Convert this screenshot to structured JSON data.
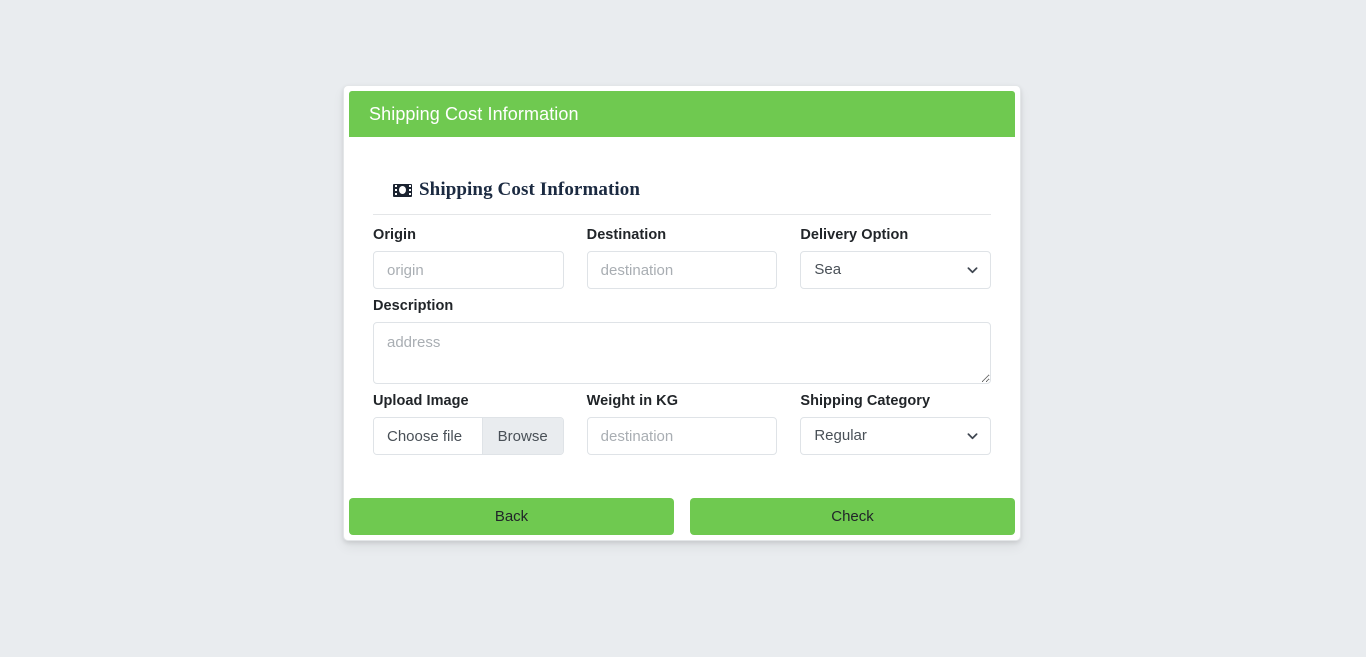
{
  "theme": {
    "accent_green": "#6fc950",
    "page_background": "#e9ecef",
    "card_background": "#ffffff",
    "input_border": "#dfe3e7",
    "label_color": "#212529"
  },
  "card": {
    "header_title": "Shipping Cost Information",
    "legend": {
      "icon": "money-bill-icon",
      "text": "Shipping Cost Information"
    }
  },
  "form": {
    "origin": {
      "label": "Origin",
      "placeholder": "origin",
      "value": ""
    },
    "destination": {
      "label": "Destination",
      "placeholder": "destination",
      "value": ""
    },
    "delivery_option": {
      "label": "Delivery Option",
      "selected": "Sea",
      "options": [
        "Sea"
      ],
      "chevron": "chevron-down-icon"
    },
    "description": {
      "label": "Description",
      "placeholder": "address",
      "value": ""
    },
    "upload_image": {
      "label": "Upload Image",
      "file_name": "Choose file",
      "browse_label": "Browse"
    },
    "weight": {
      "label": "Weight in KG",
      "placeholder": "destination",
      "value": ""
    },
    "shipping_category": {
      "label": "Shipping Category",
      "selected": "Regular",
      "options": [
        "Regular"
      ],
      "chevron": "chevron-down-icon"
    }
  },
  "actions": {
    "back_label": "Back",
    "check_label": "Check"
  }
}
